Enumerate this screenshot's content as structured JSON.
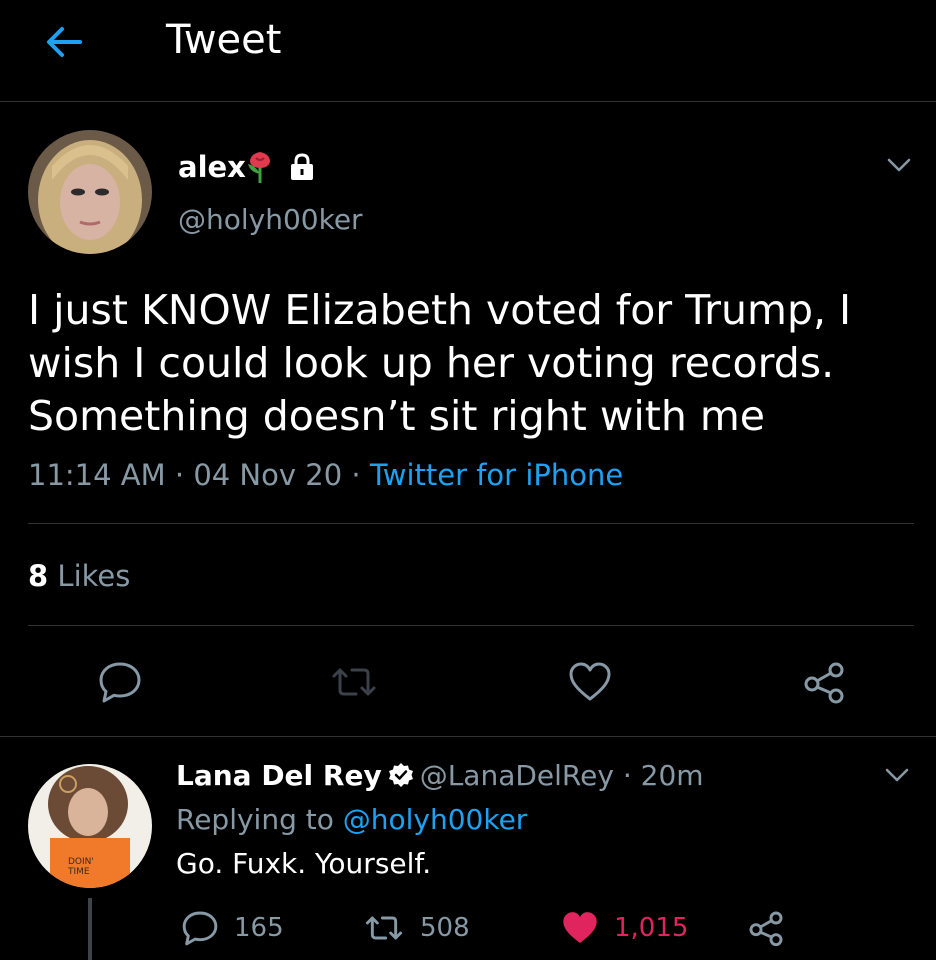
{
  "header": {
    "title": "Tweet"
  },
  "tweet": {
    "display_name": "alex",
    "handle": "@holyh00ker",
    "text": "I just KNOW Elizabeth voted for Trump, I wish I could look up her voting records. Something doesn’t sit right with me",
    "time": "11:14 AM",
    "dot": "·",
    "date": "04 Nov 20",
    "source": "Twitter for iPhone",
    "likes_count": "8",
    "likes_label": "Likes"
  },
  "reply": {
    "display_name": "Lana Del Rey",
    "handle": "@LanaDelRey",
    "age": "· 20m",
    "replying_prefix": "Replying to",
    "replying_handle": "@holyh00ker",
    "text": "Go. Fuxk. Yourself.",
    "reply_count": "165",
    "retweet_count": "508",
    "like_count": "1,015"
  },
  "colors": {
    "accent": "#1da1f2",
    "muted": "#8899a6",
    "like": "#e0245e",
    "divider": "#2f3336"
  },
  "icons": [
    "back-arrow-icon",
    "rose-emoji-icon",
    "lock-icon",
    "chevron-down-icon",
    "reply-icon",
    "retweet-icon",
    "heart-icon",
    "share-icon",
    "verified-badge-icon"
  ]
}
